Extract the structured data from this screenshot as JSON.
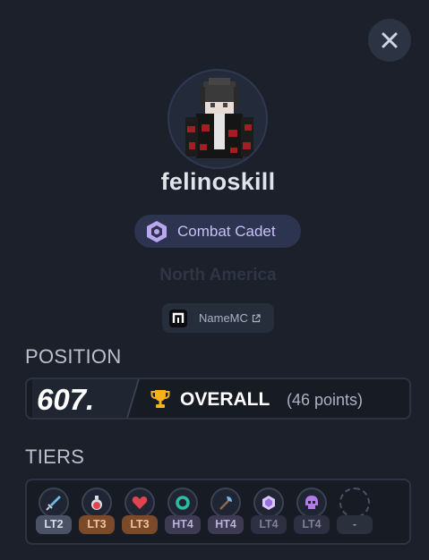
{
  "player": {
    "username": "felinoskill",
    "rank": "Combat Cadet",
    "region": "North America"
  },
  "links": {
    "namemc_label": "NameMC"
  },
  "position": {
    "section_title": "POSITION",
    "number": "607.",
    "overall_label": "OVERALL",
    "points_text": "(46 points)"
  },
  "tiers": {
    "section_title": "TIERS",
    "items": [
      {
        "mode_icon": "sword-icon",
        "tier": "LT2",
        "badge_bg": "#4a5366",
        "badge_fg": "#d8dde6"
      },
      {
        "mode_icon": "potion-icon",
        "tier": "LT3",
        "badge_bg": "#7a4a2a",
        "badge_fg": "#f2c39b"
      },
      {
        "mode_icon": "heart-icon",
        "tier": "LT3",
        "badge_bg": "#7a4a2a",
        "badge_fg": "#f2c39b"
      },
      {
        "mode_icon": "ring-icon",
        "tier": "HT4",
        "badge_bg": "#3d3a52",
        "badge_fg": "#b8b2d6"
      },
      {
        "mode_icon": "axe-icon",
        "tier": "HT4",
        "badge_bg": "#3d3a52",
        "badge_fg": "#b8b2d6"
      },
      {
        "mode_icon": "gem-icon",
        "tier": "LT4",
        "badge_bg": "#2e2f40",
        "badge_fg": "#7d7f95"
      },
      {
        "mode_icon": "skull-icon",
        "tier": "LT4",
        "badge_bg": "#2e2f40",
        "badge_fg": "#7d7f95"
      },
      {
        "mode_icon": "empty-slot-icon",
        "tier": "-",
        "badge_bg": "#2a303c",
        "badge_fg": "#8a92a3"
      }
    ]
  },
  "colors": {
    "background": "#1b202b",
    "accent_purple": "#c9bff5",
    "trophy_gold": "#f5b21b"
  }
}
